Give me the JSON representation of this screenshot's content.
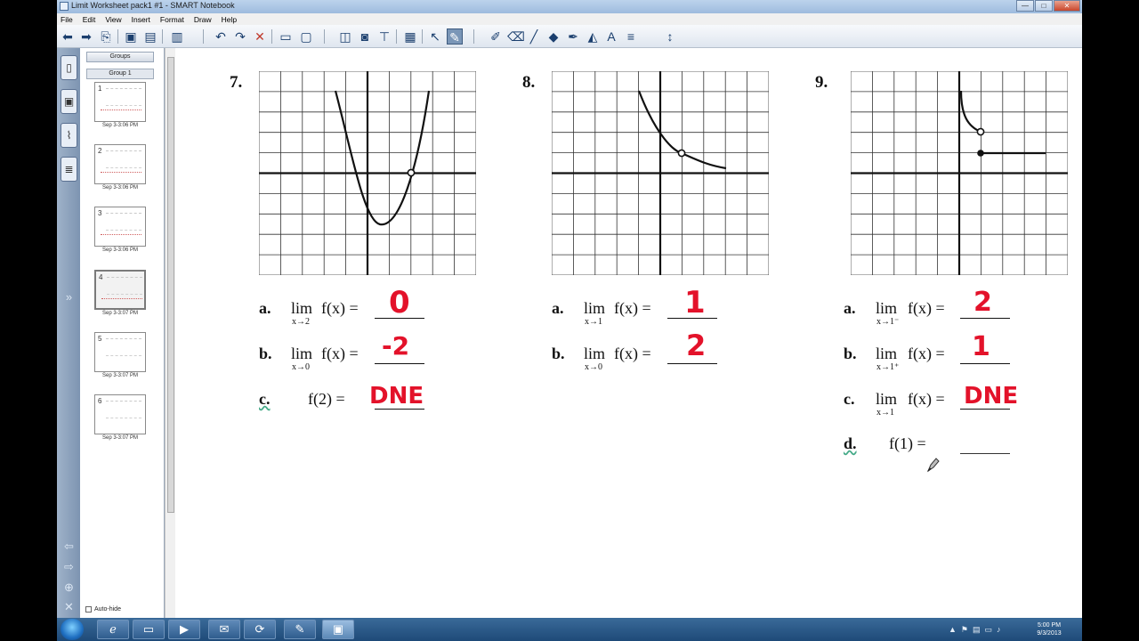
{
  "window": {
    "title": "Limit Worksheet pack1 #1 - SMART Notebook",
    "minimize": "—",
    "maximize": "□",
    "close": "✕"
  },
  "menu": [
    "File",
    "Edit",
    "View",
    "Insert",
    "Format",
    "Draw",
    "Help"
  ],
  "sorter": {
    "groups_label": "Groups",
    "group_name": "Group 1",
    "pages": [
      {
        "num": "1",
        "date": "Sep 3-3:06 PM"
      },
      {
        "num": "2",
        "date": "Sep 3-3:06 PM"
      },
      {
        "num": "3",
        "date": "Sep 3-3:06 PM"
      },
      {
        "num": "4",
        "date": "Sep 3-3:07 PM"
      },
      {
        "num": "5",
        "date": "Sep 3-3:07 PM"
      },
      {
        "num": "6",
        "date": "Sep 3-3:07 PM"
      }
    ],
    "autohide_label": "Auto-hide"
  },
  "problems": [
    {
      "number": "7.",
      "parts": [
        {
          "letter": "a.",
          "kind": "lim",
          "sub": "x→2",
          "expr": "f(x) =",
          "answer": "0"
        },
        {
          "letter": "b.",
          "kind": "lim",
          "sub": "x→0",
          "expr": "f(x) =",
          "answer": "-2"
        },
        {
          "letter": "c.",
          "kind": "plain",
          "expr": "f(2) =",
          "answer": "DNE"
        }
      ]
    },
    {
      "number": "8.",
      "parts": [
        {
          "letter": "a.",
          "kind": "lim",
          "sub": "x→1",
          "expr": "f(x) =",
          "answer": "1"
        },
        {
          "letter": "b.",
          "kind": "lim",
          "sub": "x→0",
          "expr": "f(x) =",
          "answer": "2"
        }
      ]
    },
    {
      "number": "9.",
      "parts": [
        {
          "letter": "a.",
          "kind": "lim",
          "sub": "x→1⁻",
          "expr": "f(x) =",
          "answer": "2"
        },
        {
          "letter": "b.",
          "kind": "lim",
          "sub": "x→1⁺",
          "expr": "f(x) =",
          "answer": "1"
        },
        {
          "letter": "c.",
          "kind": "lim",
          "sub": "x→1",
          "expr": "f(x) =",
          "answer": "DNE"
        },
        {
          "letter": "d.",
          "kind": "plain",
          "expr": "f(1) =",
          "answer": ""
        }
      ]
    }
  ],
  "lim_word": "lim",
  "clock": {
    "time": "5:00 PM",
    "date": "9/3/2013"
  },
  "colors": {
    "answer_ink": "#e3122a",
    "grid_line": "#222222"
  }
}
